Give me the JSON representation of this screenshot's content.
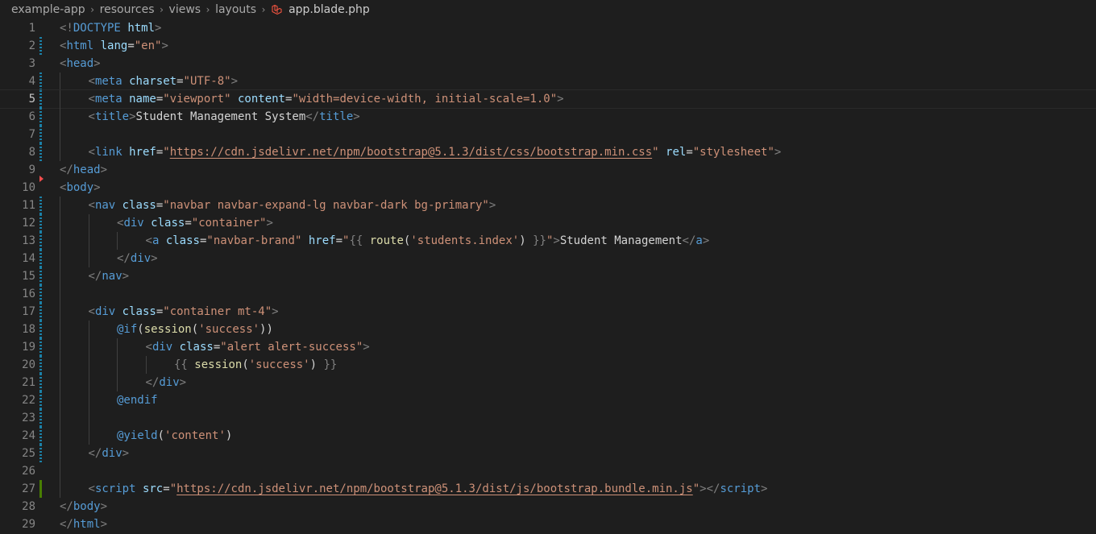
{
  "breadcrumb": {
    "items": [
      "example-app",
      "resources",
      "views",
      "layouts"
    ],
    "file": "app.blade.php",
    "file_icon": "laravel-blade-icon"
  },
  "editor": {
    "active_line": 5,
    "lines": [
      {
        "n": "1",
        "indent": 0,
        "git": "",
        "t": [
          [
            "p",
            "<!"
          ],
          [
            "tag",
            "DOCTYPE"
          ],
          [
            "txt",
            " "
          ],
          [
            "attr",
            "html"
          ],
          [
            "p",
            ">"
          ]
        ]
      },
      {
        "n": "2",
        "indent": 0,
        "git": "mod",
        "t": [
          [
            "p",
            "<"
          ],
          [
            "tag",
            "html"
          ],
          [
            "txt",
            " "
          ],
          [
            "attr",
            "lang"
          ],
          [
            "txt",
            "="
          ],
          [
            "str",
            "\"en\""
          ],
          [
            "p",
            ">"
          ]
        ]
      },
      {
        "n": "3",
        "indent": 0,
        "git": "",
        "t": [
          [
            "p",
            "<"
          ],
          [
            "tag",
            "head"
          ],
          [
            "p",
            ">"
          ]
        ]
      },
      {
        "n": "4",
        "indent": 1,
        "git": "mod",
        "t": [
          [
            "p",
            "<"
          ],
          [
            "tag",
            "meta"
          ],
          [
            "txt",
            " "
          ],
          [
            "attr",
            "charset"
          ],
          [
            "txt",
            "="
          ],
          [
            "str",
            "\"UTF-8\""
          ],
          [
            "p",
            ">"
          ]
        ]
      },
      {
        "n": "5",
        "indent": 1,
        "git": "mod",
        "t": [
          [
            "p",
            "<"
          ],
          [
            "tag",
            "meta"
          ],
          [
            "txt",
            " "
          ],
          [
            "attr",
            "name"
          ],
          [
            "txt",
            "="
          ],
          [
            "str",
            "\"viewport\""
          ],
          [
            "txt",
            " "
          ],
          [
            "attr",
            "content"
          ],
          [
            "txt",
            "="
          ],
          [
            "str",
            "\"width=device-width, initial-scale=1.0\""
          ],
          [
            "p",
            ">"
          ]
        ]
      },
      {
        "n": "6",
        "indent": 1,
        "git": "mod",
        "t": [
          [
            "p",
            "<"
          ],
          [
            "tag",
            "title"
          ],
          [
            "p",
            ">"
          ],
          [
            "txt",
            "Student Management System"
          ],
          [
            "p",
            "</"
          ],
          [
            "tag",
            "title"
          ],
          [
            "p",
            ">"
          ]
        ]
      },
      {
        "n": "7",
        "indent": 1,
        "git": "mod",
        "t": []
      },
      {
        "n": "8",
        "indent": 1,
        "git": "mod",
        "t": [
          [
            "p",
            "<"
          ],
          [
            "tag",
            "link"
          ],
          [
            "txt",
            " "
          ],
          [
            "attr",
            "href"
          ],
          [
            "txt",
            "="
          ],
          [
            "str",
            "\""
          ],
          [
            "link",
            "https://cdn.jsdelivr.net/npm/bootstrap@5.1.3/dist/css/bootstrap.min.css"
          ],
          [
            "str",
            "\""
          ],
          [
            "txt",
            " "
          ],
          [
            "attr",
            "rel"
          ],
          [
            "txt",
            "="
          ],
          [
            "str",
            "\"stylesheet\""
          ],
          [
            "p",
            ">"
          ]
        ]
      },
      {
        "n": "9",
        "indent": 0,
        "git": "del",
        "t": [
          [
            "p",
            "</"
          ],
          [
            "tag",
            "head"
          ],
          [
            "p",
            ">"
          ]
        ]
      },
      {
        "n": "10",
        "indent": 0,
        "git": "",
        "t": [
          [
            "p",
            "<"
          ],
          [
            "tag",
            "body"
          ],
          [
            "p",
            ">"
          ]
        ]
      },
      {
        "n": "11",
        "indent": 1,
        "git": "mod",
        "t": [
          [
            "p",
            "<"
          ],
          [
            "tag",
            "nav"
          ],
          [
            "txt",
            " "
          ],
          [
            "attr",
            "class"
          ],
          [
            "txt",
            "="
          ],
          [
            "str",
            "\"navbar navbar-expand-lg navbar-dark bg-primary\""
          ],
          [
            "p",
            ">"
          ]
        ]
      },
      {
        "n": "12",
        "indent": 2,
        "git": "mod",
        "t": [
          [
            "p",
            "<"
          ],
          [
            "tag",
            "div"
          ],
          [
            "txt",
            " "
          ],
          [
            "attr",
            "class"
          ],
          [
            "txt",
            "="
          ],
          [
            "str",
            "\"container\""
          ],
          [
            "p",
            ">"
          ]
        ]
      },
      {
        "n": "13",
        "indent": 3,
        "git": "mod",
        "t": [
          [
            "p",
            "<"
          ],
          [
            "tag",
            "a"
          ],
          [
            "txt",
            " "
          ],
          [
            "attr",
            "class"
          ],
          [
            "txt",
            "="
          ],
          [
            "str",
            "\"navbar-brand\""
          ],
          [
            "txt",
            " "
          ],
          [
            "attr",
            "href"
          ],
          [
            "txt",
            "="
          ],
          [
            "str",
            "\""
          ],
          [
            "p",
            "{{ "
          ],
          [
            "fn",
            "route"
          ],
          [
            "txt",
            "("
          ],
          [
            "str",
            "'students.index'"
          ],
          [
            "txt",
            ")"
          ],
          [
            "p",
            " }}"
          ],
          [
            "str",
            "\""
          ],
          [
            "p",
            ">"
          ],
          [
            "txt",
            "Student Management"
          ],
          [
            "p",
            "</"
          ],
          [
            "tag",
            "a"
          ],
          [
            "p",
            ">"
          ]
        ]
      },
      {
        "n": "14",
        "indent": 2,
        "git": "mod",
        "t": [
          [
            "p",
            "</"
          ],
          [
            "tag",
            "div"
          ],
          [
            "p",
            ">"
          ]
        ]
      },
      {
        "n": "15",
        "indent": 1,
        "git": "mod",
        "t": [
          [
            "p",
            "</"
          ],
          [
            "tag",
            "nav"
          ],
          [
            "p",
            ">"
          ]
        ]
      },
      {
        "n": "16",
        "indent": 1,
        "git": "mod",
        "t": []
      },
      {
        "n": "17",
        "indent": 1,
        "git": "mod",
        "t": [
          [
            "p",
            "<"
          ],
          [
            "tag",
            "div"
          ],
          [
            "txt",
            " "
          ],
          [
            "attr",
            "class"
          ],
          [
            "txt",
            "="
          ],
          [
            "str",
            "\"container mt-4\""
          ],
          [
            "p",
            ">"
          ]
        ]
      },
      {
        "n": "18",
        "indent": 2,
        "git": "mod",
        "t": [
          [
            "kw",
            "@if"
          ],
          [
            "txt",
            "("
          ],
          [
            "fn",
            "session"
          ],
          [
            "txt",
            "("
          ],
          [
            "str",
            "'success'"
          ],
          [
            "txt",
            "))"
          ]
        ]
      },
      {
        "n": "19",
        "indent": 3,
        "git": "mod",
        "t": [
          [
            "p",
            "<"
          ],
          [
            "tag",
            "div"
          ],
          [
            "txt",
            " "
          ],
          [
            "attr",
            "class"
          ],
          [
            "txt",
            "="
          ],
          [
            "str",
            "\"alert alert-success\""
          ],
          [
            "p",
            ">"
          ]
        ]
      },
      {
        "n": "20",
        "indent": 4,
        "git": "mod",
        "t": [
          [
            "p",
            "{{ "
          ],
          [
            "fn",
            "session"
          ],
          [
            "txt",
            "("
          ],
          [
            "str",
            "'success'"
          ],
          [
            "txt",
            ")"
          ],
          [
            "p",
            " }}"
          ]
        ]
      },
      {
        "n": "21",
        "indent": 3,
        "git": "mod",
        "t": [
          [
            "p",
            "</"
          ],
          [
            "tag",
            "div"
          ],
          [
            "p",
            ">"
          ]
        ]
      },
      {
        "n": "22",
        "indent": 2,
        "git": "mod",
        "t": [
          [
            "kw",
            "@endif"
          ]
        ]
      },
      {
        "n": "23",
        "indent": 2,
        "git": "mod",
        "t": []
      },
      {
        "n": "24",
        "indent": 2,
        "git": "mod",
        "t": [
          [
            "kw",
            "@yield"
          ],
          [
            "txt",
            "("
          ],
          [
            "str",
            "'content'"
          ],
          [
            "txt",
            ")"
          ]
        ]
      },
      {
        "n": "25",
        "indent": 1,
        "git": "mod",
        "t": [
          [
            "p",
            "</"
          ],
          [
            "tag",
            "div"
          ],
          [
            "p",
            ">"
          ]
        ]
      },
      {
        "n": "26",
        "indent": 1,
        "git": "",
        "t": []
      },
      {
        "n": "27",
        "indent": 1,
        "git": "add",
        "t": [
          [
            "p",
            "<"
          ],
          [
            "tag",
            "script"
          ],
          [
            "txt",
            " "
          ],
          [
            "attr",
            "src"
          ],
          [
            "txt",
            "="
          ],
          [
            "str",
            "\""
          ],
          [
            "link",
            "https://cdn.jsdelivr.net/npm/bootstrap@5.1.3/dist/js/bootstrap.bundle.min.js"
          ],
          [
            "str",
            "\""
          ],
          [
            "p",
            "></"
          ],
          [
            "tag",
            "script"
          ],
          [
            "p",
            ">"
          ]
        ]
      },
      {
        "n": "28",
        "indent": 0,
        "git": "",
        "t": [
          [
            "p",
            "</"
          ],
          [
            "tag",
            "body"
          ],
          [
            "p",
            ">"
          ]
        ]
      },
      {
        "n": "29",
        "indent": 0,
        "git": "",
        "t": [
          [
            "p",
            "</"
          ],
          [
            "tag",
            "html"
          ],
          [
            "p",
            ">"
          ]
        ]
      }
    ]
  },
  "colors": {
    "background": "#1e1e1e",
    "line_number": "#858585",
    "tag": "#569cd6",
    "attribute": "#9cdcfe",
    "string": "#ce9178",
    "function": "#dcdcaa",
    "punctuation": "#808080",
    "git_modified": "#1b81a8",
    "git_added": "#487e02",
    "git_deleted": "#f14c4c"
  }
}
